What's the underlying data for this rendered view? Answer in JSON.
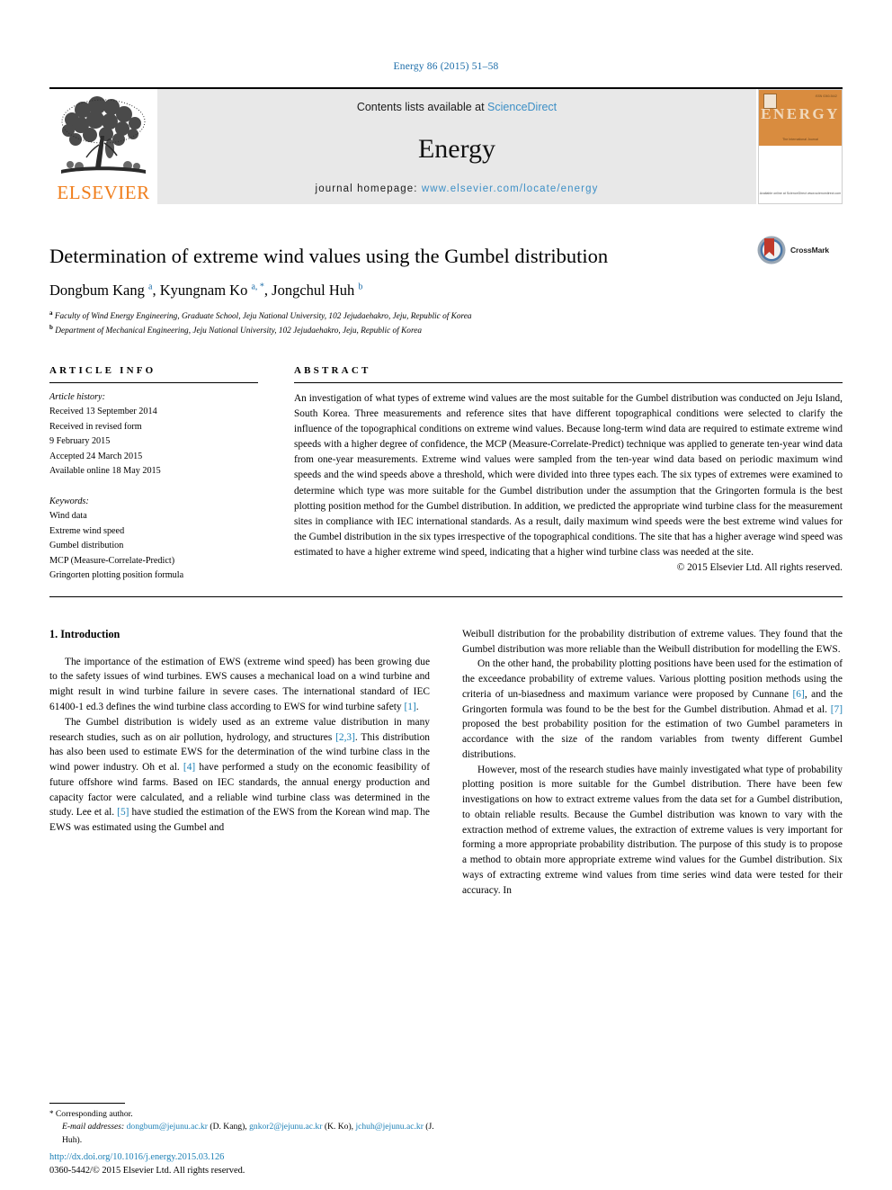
{
  "running_head": "Energy 86 (2015) 51–58",
  "masthead": {
    "publisher": "ELSEVIER",
    "contents_line_prefix": "Contents lists available at ",
    "sciencedirect": "ScienceDirect",
    "journal_name": "Energy",
    "homepage_label": "journal homepage: ",
    "homepage_url": "www.elsevier.com/locate/energy",
    "cover": {
      "title": "ENERGY",
      "subtitle": "The International Journal",
      "issue_code": "ISSN 0360-5442",
      "footer": "Available online at\nScienceDirect\nwww.sciencedirect.com"
    }
  },
  "article": {
    "title": "Determination of extreme wind values using the Gumbel distribution",
    "authors": [
      {
        "name": "Dongbum Kang",
        "marks": "a"
      },
      {
        "name": "Kyungnam Ko",
        "marks": "a, *"
      },
      {
        "name": "Jongchul Huh",
        "marks": "b"
      }
    ],
    "affiliations": [
      {
        "mark": "a",
        "text": "Faculty of Wind Energy Engineering, Graduate School, Jeju National University, 102 Jejudaehakro, Jeju, Republic of Korea"
      },
      {
        "mark": "b",
        "text": "Department of Mechanical Engineering, Jeju National University, 102 Jejudaehakro, Jeju, Republic of Korea"
      }
    ],
    "crossmark_label": "CrossMark"
  },
  "article_info": {
    "heading": "ARTICLE INFO",
    "history_label": "Article history:",
    "history": [
      "Received 13 September 2014",
      "Received in revised form",
      "9 February 2015",
      "Accepted 24 March 2015",
      "Available online 18 May 2015"
    ],
    "keywords_label": "Keywords:",
    "keywords": [
      "Wind data",
      "Extreme wind speed",
      "Gumbel distribution",
      "MCP (Measure-Correlate-Predict)",
      "Gringorten plotting position formula"
    ]
  },
  "abstract": {
    "heading": "ABSTRACT",
    "text": "An investigation of what types of extreme wind values are the most suitable for the Gumbel distribution was conducted on Jeju Island, South Korea. Three measurements and reference sites that have different topographical conditions were selected to clarify the influence of the topographical conditions on extreme wind values. Because long-term wind data are required to estimate extreme wind speeds with a higher degree of confidence, the MCP (Measure-Correlate-Predict) technique was applied to generate ten-year wind data from one-year measurements. Extreme wind values were sampled from the ten-year wind data based on periodic maximum wind speeds and the wind speeds above a threshold, which were divided into three types each. The six types of extremes were examined to determine which type was more suitable for the Gumbel distribution under the assumption that the Gringorten formula is the best plotting position method for the Gumbel distribution. In addition, we predicted the appropriate wind turbine class for the measurement sites in compliance with IEC international standards. As a result, daily maximum wind speeds were the best extreme wind values for the Gumbel distribution in the six types irrespective of the topographical conditions. The site that has a higher average wind speed was estimated to have a higher extreme wind speed, indicating that a higher wind turbine class was needed at the site.",
    "copyright": "© 2015 Elsevier Ltd. All rights reserved."
  },
  "introduction": {
    "heading": "1. Introduction",
    "left_paragraphs": [
      "The importance of the estimation of EWS (extreme wind speed) has been growing due to the safety issues of wind turbines. EWS causes a mechanical load on a wind turbine and might result in wind turbine failure in severe cases. The international standard of IEC 61400-1 ed.3 defines the wind turbine class according to EWS for wind turbine safety [1].",
      "The Gumbel distribution is widely used as an extreme value distribution in many research studies, such as on air pollution, hydrology, and structures [2,3]. This distribution has also been used to estimate EWS for the determination of the wind turbine class in the wind power industry. Oh et al. [4] have performed a study on the economic feasibility of future offshore wind farms. Based on IEC standards, the annual energy production and capacity factor were calculated, and a reliable wind turbine class was determined in the study. Lee et al. [5] have studied the estimation of the EWS from the Korean wind map. The EWS was estimated using the Gumbel and"
    ],
    "right_paragraphs": [
      "Weibull distribution for the probability distribution of extreme values. They found that the Gumbel distribution was more reliable than the Weibull distribution for modelling the EWS.",
      "On the other hand, the probability plotting positions have been used for the estimation of the exceedance probability of extreme values. Various plotting position methods using the criteria of un-biasedness and maximum variance were proposed by Cunnane [6], and the Gringorten formula was found to be the best for the Gumbel distribution. Ahmad et al. [7] proposed the best probability position for the estimation of two Gumbel parameters in accordance with the size of the random variables from twenty different Gumbel distributions.",
      "However, most of the research studies have mainly investigated what type of probability plotting position is more suitable for the Gumbel distribution. There have been few investigations on how to extract extreme values from the data set for a Gumbel distribution, to obtain reliable results. Because the Gumbel distribution was known to vary with the extraction method of extreme values, the extraction of extreme values is very important for forming a more appropriate probability distribution. The purpose of this study is to propose a method to obtain more appropriate extreme wind values for the Gumbel distribution. Six ways of extracting extreme wind values from time series wind data were tested for their accuracy. In"
    ]
  },
  "footnotes": {
    "corresponding": "Corresponding author.",
    "email_label": "E-mail addresses:",
    "emails": [
      {
        "address": "dongbum@jejunu.ac.kr",
        "person": "(D. Kang)"
      },
      {
        "address": "gnkor2@jejunu.ac.kr",
        "person": "(K. Ko)"
      },
      {
        "address": "jchuh@jejunu.ac.kr",
        "person": "(J. Huh)"
      }
    ]
  },
  "footer": {
    "doi": "http://dx.doi.org/10.1016/j.energy.2015.03.126",
    "issn_line": "0360-5442/© 2015 Elsevier Ltd. All rights reserved."
  },
  "colors": {
    "link_blue": "#1b7fb5",
    "banner_gray": "#e8e8e8",
    "elsevier_orange": "#f07d1a"
  }
}
